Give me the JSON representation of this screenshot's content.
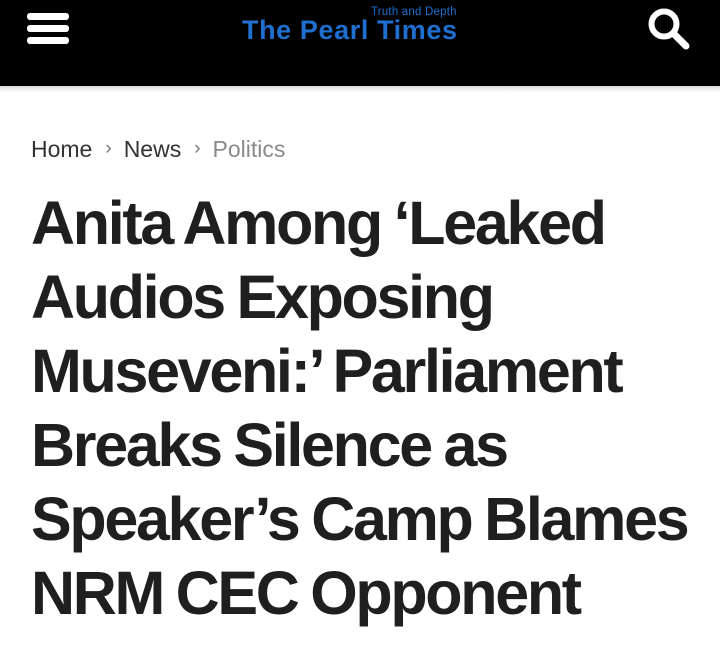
{
  "header": {
    "site_name": "The Pearl Times",
    "tagline": "Truth and Depth",
    "menu_icon": "hamburger-menu-icon",
    "search_icon": "search-icon",
    "background_color": "#000000",
    "logo_color": "#1f6fd1"
  },
  "breadcrumb": {
    "items": [
      "Home",
      "News",
      "Politics"
    ],
    "separator": "›"
  },
  "article": {
    "title_lines": [
      "Anita Among ‘Leaked",
      "Audios Exposing",
      "Museveni:’ Parliament",
      "Breaks Silence as",
      "Speaker’s Camp Blames",
      "NRM CEC Opponent"
    ]
  }
}
